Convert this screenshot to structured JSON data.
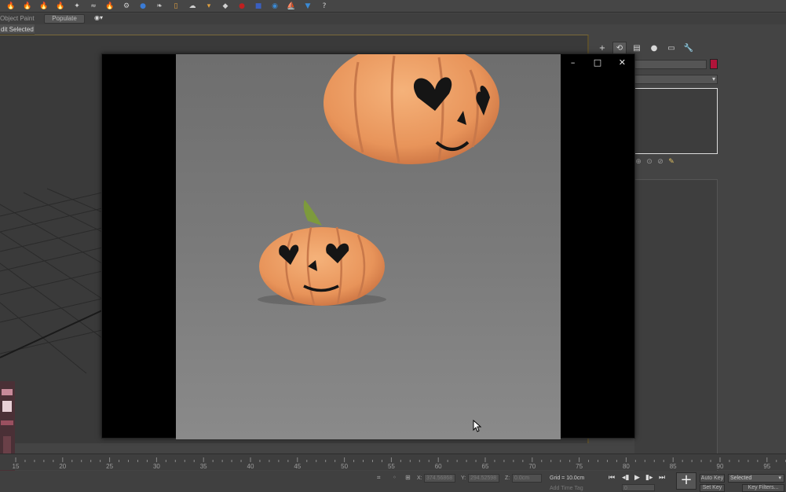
{
  "toolbar": {
    "icons": [
      {
        "name": "fire-effect-icon",
        "color": "#e07a1c",
        "glyph": "🔥"
      },
      {
        "name": "fire-effect-icon",
        "color": "#e07a1c",
        "glyph": "🔥"
      },
      {
        "name": "fire-effect-icon",
        "color": "#e07a1c",
        "glyph": "🔥"
      },
      {
        "name": "fire-effect-icon",
        "color": "#e07a1c",
        "glyph": "🔥"
      },
      {
        "name": "particle-icon",
        "color": "#d0d0d0",
        "glyph": "✦"
      },
      {
        "name": "wave-icon",
        "color": "#d0d0d0",
        "glyph": "≈"
      },
      {
        "name": "fire-effect-icon",
        "color": "#e07a1c",
        "glyph": "🔥"
      },
      {
        "name": "smoke-icon",
        "color": "#d0d0d0",
        "glyph": "⚙"
      },
      {
        "name": "sphere-icon",
        "color": "#3a7bd5",
        "glyph": "●"
      },
      {
        "name": "leaf-icon",
        "color": "#d0d0d0",
        "glyph": "❧"
      },
      {
        "name": "mug-icon",
        "color": "#e0a040",
        "glyph": "▯"
      },
      {
        "name": "cloud-icon",
        "color": "#d0d0d0",
        "glyph": "☁"
      },
      {
        "name": "bucket-icon",
        "color": "#e0a040",
        "glyph": "▾"
      },
      {
        "name": "gem-icon",
        "color": "#d0d0d0",
        "glyph": "◆"
      },
      {
        "name": "apple-icon",
        "color": "#c02020",
        "glyph": "●"
      },
      {
        "name": "shield-icon",
        "color": "#3a5fc0",
        "glyph": "■"
      },
      {
        "name": "water-icon",
        "color": "#3a8ad5",
        "glyph": "◉"
      },
      {
        "name": "boat-icon",
        "color": "#d0d0d0",
        "glyph": "⛵"
      },
      {
        "name": "bucket-water-icon",
        "color": "#3a8ad5",
        "glyph": "▼"
      },
      {
        "name": "help-icon",
        "color": "#d0d0d0",
        "glyph": "?"
      }
    ]
  },
  "ribbon": {
    "object_paint_label": "Object Paint",
    "populate_label": "Populate",
    "edit_selected_label": "dit Selected"
  },
  "command_panel": {
    "tabs": [
      "+",
      "⟲",
      "▤",
      "●",
      "▭",
      "🔧"
    ],
    "swatch_color": "#b0143a",
    "list_buttons": [
      "⊕",
      "⊙",
      "⊘",
      "✎"
    ]
  },
  "image_window": {
    "controls": {
      "minimize": "–",
      "maximize": "□",
      "close": "✕"
    }
  },
  "timeline": {
    "ticks": [
      "15",
      "20",
      "25",
      "30",
      "35",
      "40",
      "45",
      "50",
      "55",
      "60",
      "65",
      "70",
      "75",
      "80",
      "85",
      "90",
      "95"
    ]
  },
  "status_bar": {
    "x_label": "X:",
    "x_value": "374.56868",
    "y_label": "Y:",
    "y_value": "294.52598",
    "z_label": "Z:",
    "z_value": "0.0cm",
    "grid_text": "Grid = 10.0cm",
    "add_time_tag": "Add Time Tag",
    "auto_key": "Auto Key",
    "set_key": "Set Key",
    "selected_option": "Selected",
    "key_filters": "Key Filters...",
    "frame_value": "0"
  }
}
